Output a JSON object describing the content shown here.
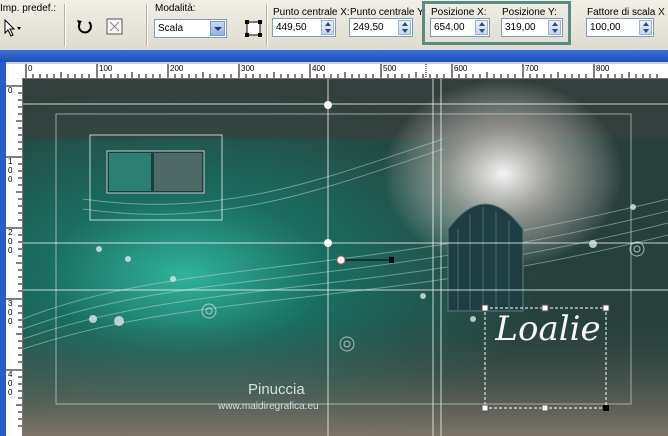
{
  "toolbar": {
    "preset_label": "Imp. predef.:",
    "mode_label": "Modalità:",
    "mode_value": "Scala",
    "center_x_label": "Punto centrale X:",
    "center_x_value": "449,50",
    "center_y_label": "Punto centrale Y:",
    "center_y_value": "249,50",
    "pos_x_label": "Posizione X:",
    "pos_x_value": "654,00",
    "pos_y_label": "Posizione Y:",
    "pos_y_value": "319,00",
    "scale_x_label": "Fattore di scala X (%",
    "scale_x_value": "100,00",
    "highlight_color": "#5b8b83"
  },
  "ruler": {
    "h_ticks": [
      "0",
      "100",
      "200",
      "300",
      "400",
      "500",
      "600",
      "700",
      "800"
    ],
    "v_ticks": [
      "0",
      "100",
      "200",
      "300",
      "400"
    ]
  },
  "canvas": {
    "brand_text": "Loalie",
    "watermark_name": "Pinuccia",
    "watermark_url": "www.maidiregrafica.eu",
    "icons": [
      "pointer-icon",
      "reset-icon",
      "deform-icon"
    ]
  }
}
